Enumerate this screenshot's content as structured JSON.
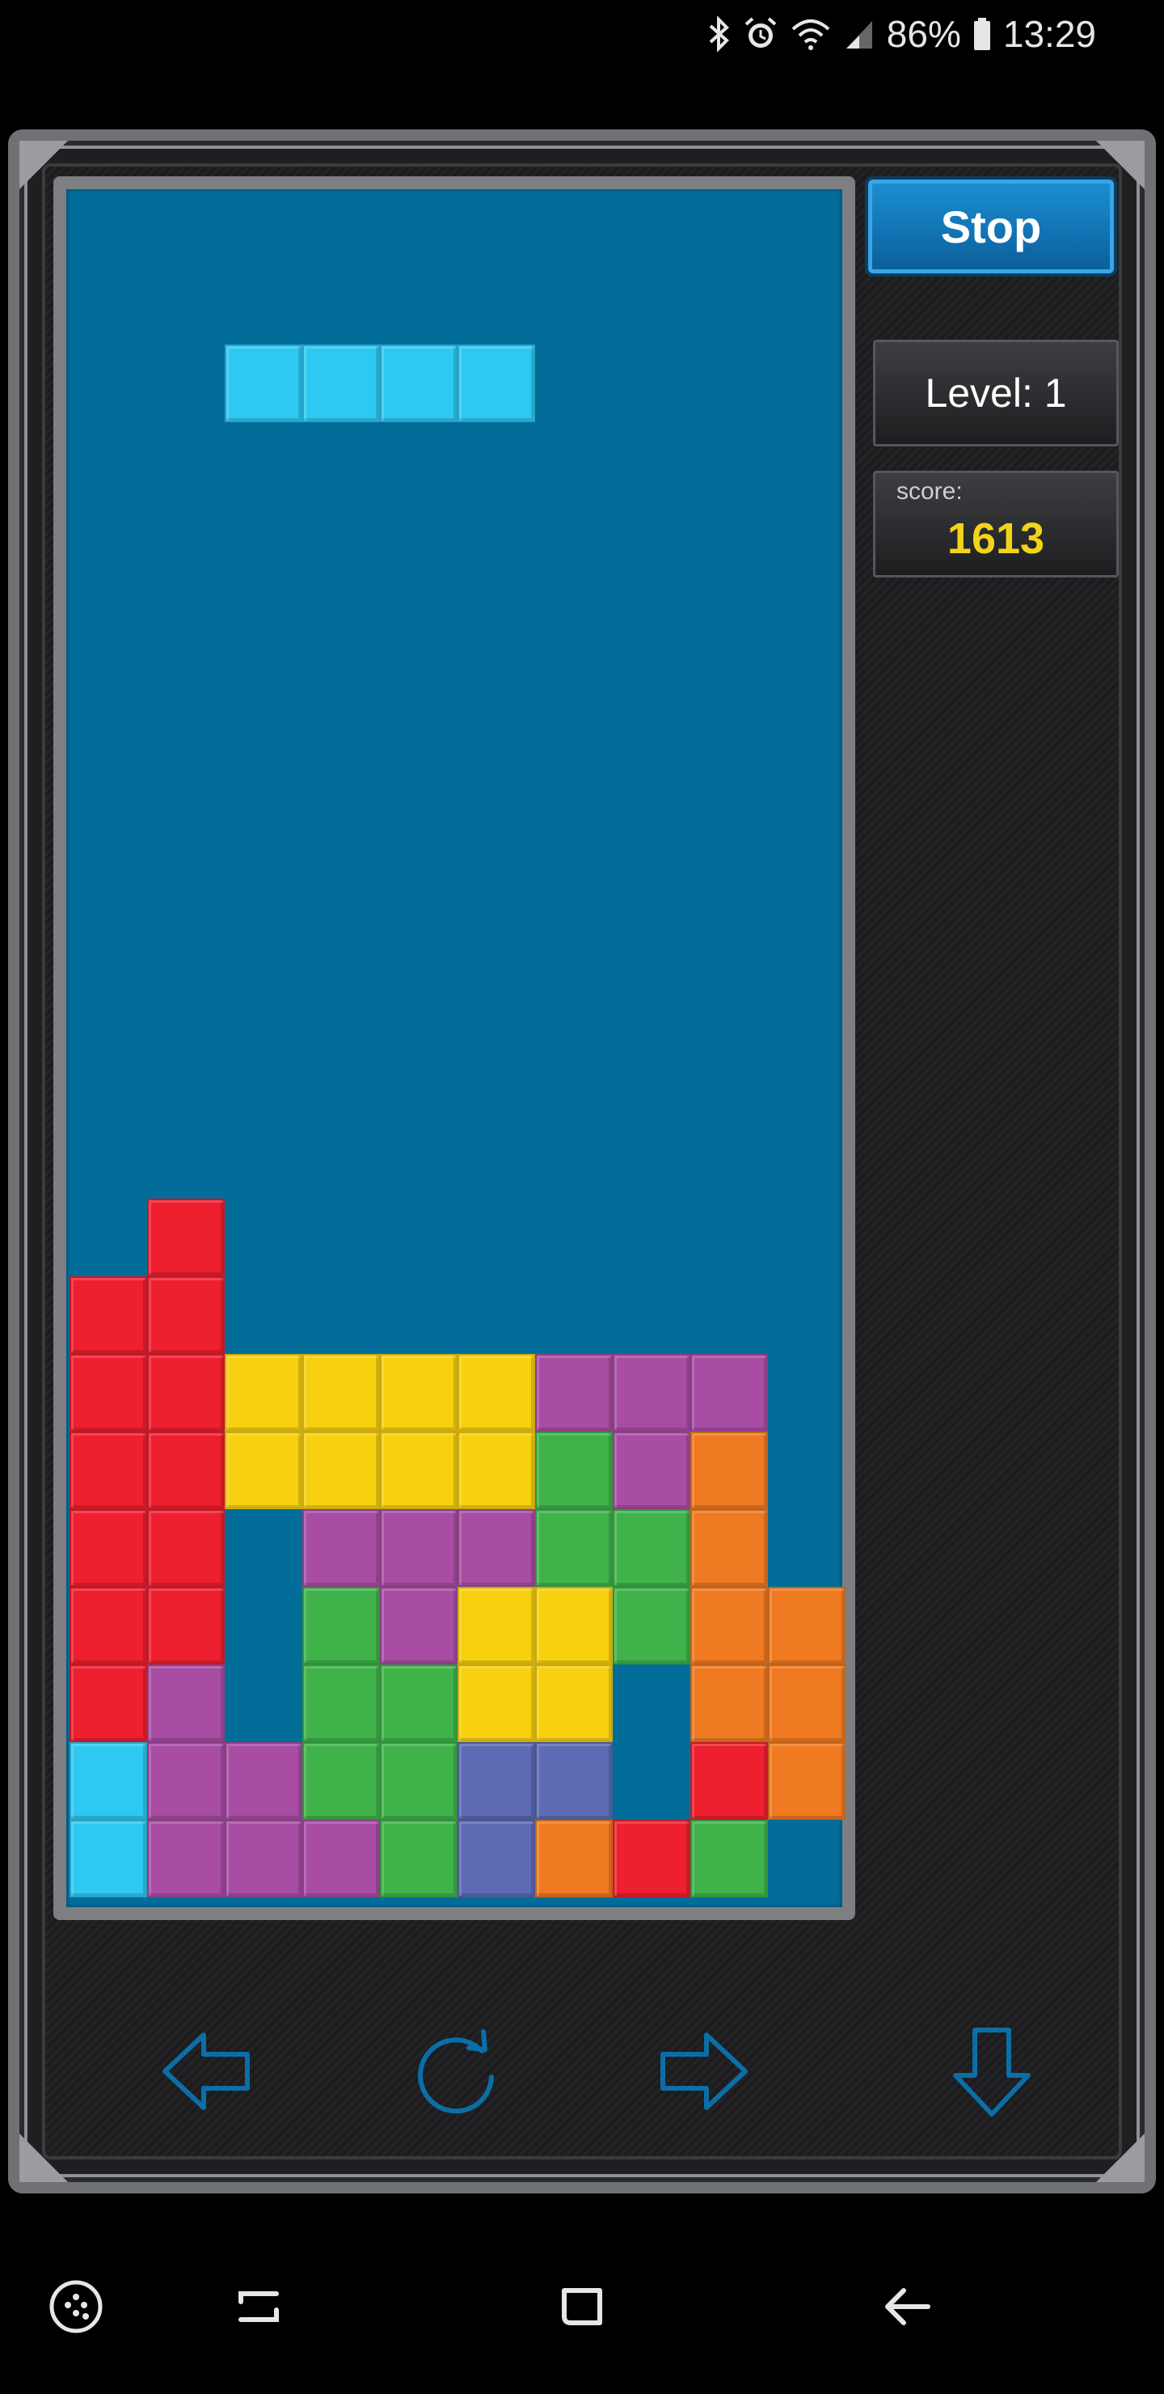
{
  "status_bar": {
    "battery": "86%",
    "time": "13:29",
    "icons": [
      "bluetooth-icon",
      "alarm-icon",
      "wifi-icon",
      "signal-icon",
      "battery-icon"
    ]
  },
  "game": {
    "stop_label": "Stop",
    "level_text": "Level: 1",
    "score_label": "score:",
    "score_value": "1613"
  },
  "board": {
    "columns": 10,
    "rows": 22,
    "colors": {
      "R": "#ee1f2f",
      "Y": "#f7d00f",
      "P": "#a84da3",
      "G": "#3fb34a",
      "O": "#ef7a22",
      "C": "#2fc8f2",
      "B": "#5c6bb4"
    },
    "active_piece": {
      "color": "C",
      "cells": [
        [
          3,
          3
        ],
        [
          4,
          3
        ],
        [
          5,
          3
        ],
        [
          6,
          3
        ]
      ]
    },
    "stack_rows": [
      ".R........",
      "RR........",
      "RRYYYYPPP.",
      "RRYYYYGPO.",
      "RR.PPPGGO.",
      "RR.GPYYGOO",
      "RP.GGYY.OO",
      "CPPGGBB.RO",
      "CPPPGBORG."
    ]
  },
  "controls": {
    "icons": [
      "move-left-icon",
      "rotate-icon",
      "move-right-icon",
      "drop-down-icon"
    ],
    "color": "#0b6ea6"
  },
  "nav_bar": {
    "icons": [
      "game-tools-icon",
      "recent-apps-icon",
      "home-icon",
      "back-icon"
    ]
  }
}
